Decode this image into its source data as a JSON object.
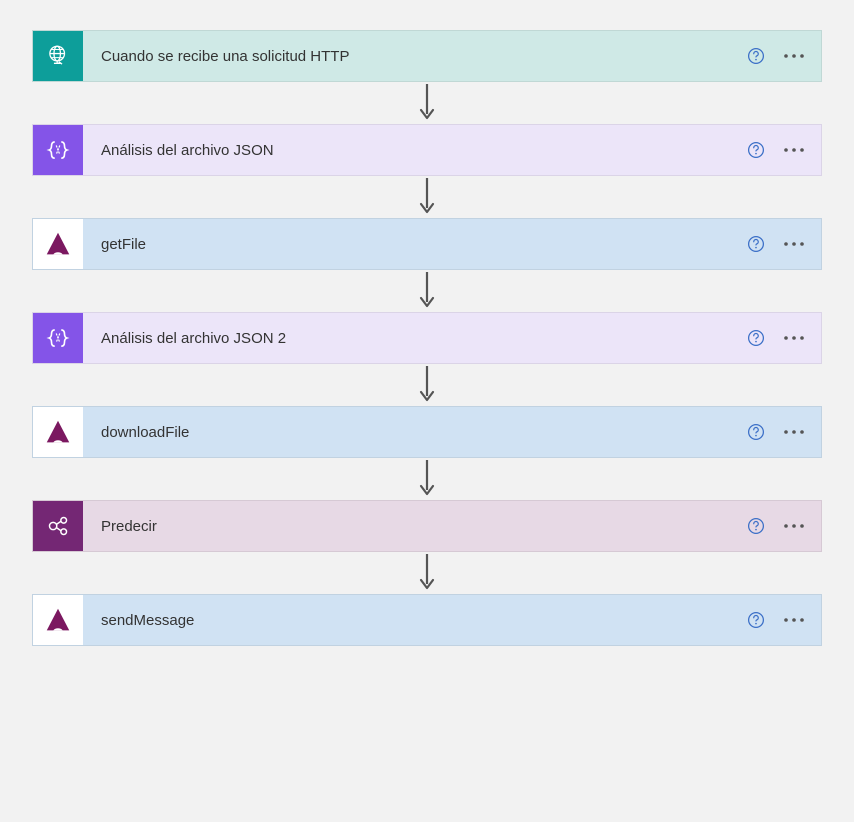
{
  "steps": [
    {
      "title": "Cuando se recibe una solicitud HTTP",
      "bg": "bg-teal-light",
      "iconBg": "icon-teal",
      "icon": "globe"
    },
    {
      "title": "Análisis del archivo JSON",
      "bg": "bg-purple-light",
      "iconBg": "icon-purple",
      "icon": "braces"
    },
    {
      "title": "getFile",
      "bg": "bg-blue-light",
      "iconBg": "icon-white",
      "icon": "mountain"
    },
    {
      "title": "Análisis del archivo JSON 2",
      "bg": "bg-purple-light",
      "iconBg": "icon-purple",
      "icon": "braces"
    },
    {
      "title": "downloadFile",
      "bg": "bg-blue-light",
      "iconBg": "icon-white",
      "icon": "mountain"
    },
    {
      "title": "Predecir",
      "bg": "bg-mauve-light",
      "iconBg": "icon-maroon",
      "icon": "nodes"
    },
    {
      "title": "sendMessage",
      "bg": "bg-blue-light",
      "iconBg": "icon-white",
      "icon": "mountain"
    }
  ]
}
